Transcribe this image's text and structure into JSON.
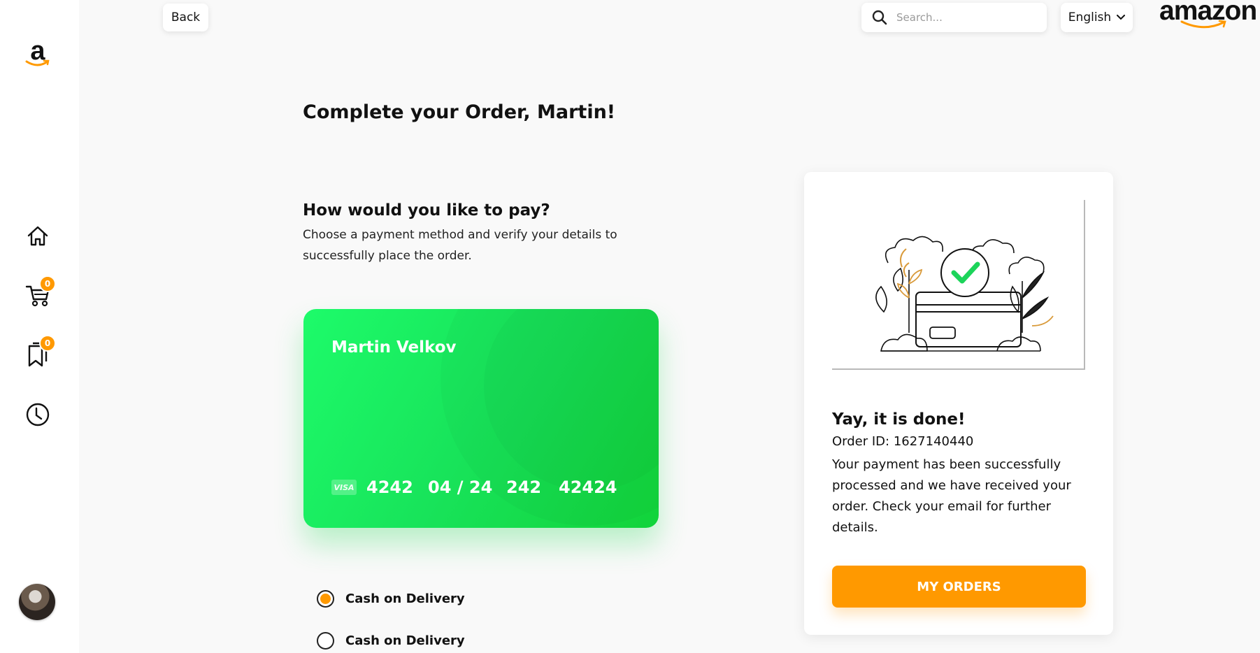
{
  "brand": {
    "sidebar_logo_letter": "a",
    "wordmark": "amazon",
    "accent_color": "#ff9900",
    "card_color": "#19e85a"
  },
  "header": {
    "back_label": "Back",
    "search_placeholder": "Search...",
    "language": "English"
  },
  "sidebar": {
    "items": [
      {
        "name": "home",
        "icon": "home-icon"
      },
      {
        "name": "cart",
        "icon": "cart-icon",
        "badge": "0"
      },
      {
        "name": "saved",
        "icon": "bookmark-icon",
        "badge": "0"
      },
      {
        "name": "history",
        "icon": "clock-icon"
      }
    ],
    "avatar": "user-avatar"
  },
  "main": {
    "title": "Complete your Order, Martin!",
    "pay_heading": "How would you like to pay?",
    "pay_description": "Choose a payment method and verify your details to successfully place the order.",
    "card": {
      "holder": "Martin Velkov",
      "brand_mark": "VISA",
      "number": "4242",
      "expiry": "04 / 24",
      "cvv": "242",
      "zip": "42424"
    },
    "payment_options": [
      {
        "label": "Cash on Delivery",
        "selected": true
      },
      {
        "label": "Cash on Delivery",
        "selected": false
      }
    ]
  },
  "success": {
    "title": "Yay, it is done!",
    "order_id": "Order ID: 1627140440",
    "message": "Your payment has been successfully processed and we have received your order. Check your email for further details.",
    "button_label": "MY ORDERS"
  }
}
